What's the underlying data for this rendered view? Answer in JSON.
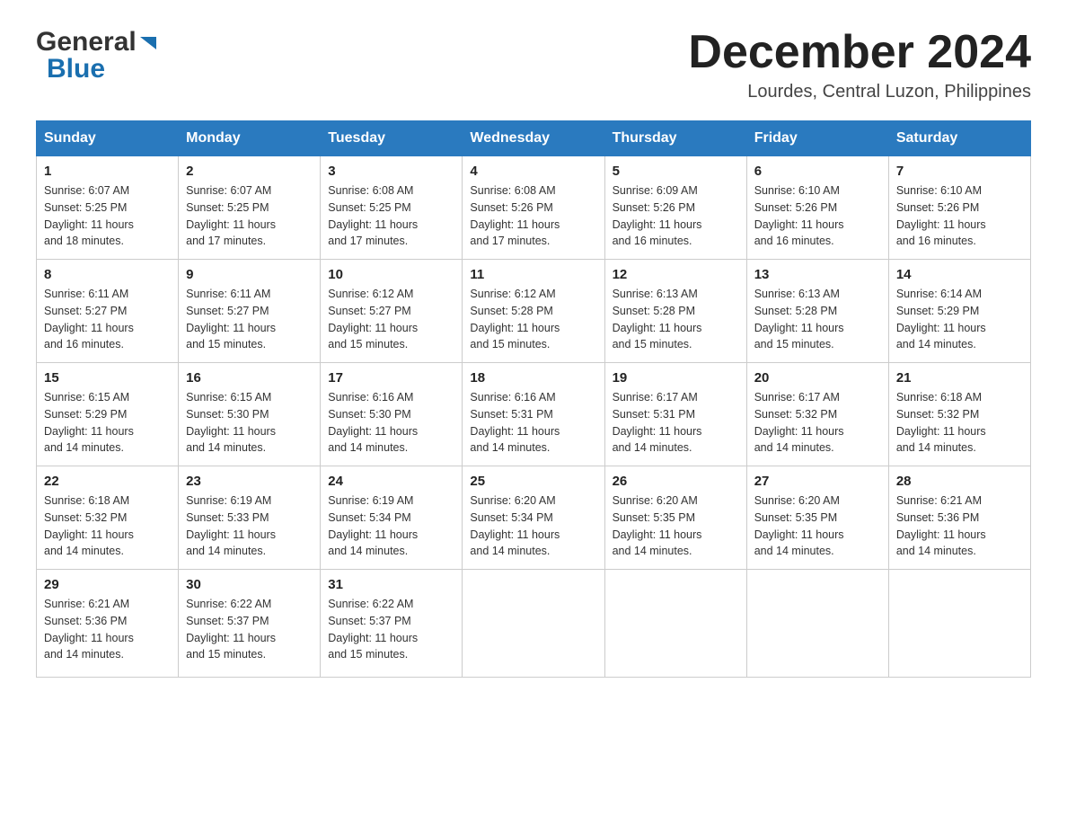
{
  "header": {
    "logo_general": "General",
    "logo_blue": "Blue",
    "month_title": "December 2024",
    "location": "Lourdes, Central Luzon, Philippines"
  },
  "days_of_week": [
    "Sunday",
    "Monday",
    "Tuesday",
    "Wednesday",
    "Thursday",
    "Friday",
    "Saturday"
  ],
  "weeks": [
    [
      {
        "day": "1",
        "sunrise": "6:07 AM",
        "sunset": "5:25 PM",
        "daylight": "11 hours and 18 minutes."
      },
      {
        "day": "2",
        "sunrise": "6:07 AM",
        "sunset": "5:25 PM",
        "daylight": "11 hours and 17 minutes."
      },
      {
        "day": "3",
        "sunrise": "6:08 AM",
        "sunset": "5:25 PM",
        "daylight": "11 hours and 17 minutes."
      },
      {
        "day": "4",
        "sunrise": "6:08 AM",
        "sunset": "5:26 PM",
        "daylight": "11 hours and 17 minutes."
      },
      {
        "day": "5",
        "sunrise": "6:09 AM",
        "sunset": "5:26 PM",
        "daylight": "11 hours and 16 minutes."
      },
      {
        "day": "6",
        "sunrise": "6:10 AM",
        "sunset": "5:26 PM",
        "daylight": "11 hours and 16 minutes."
      },
      {
        "day": "7",
        "sunrise": "6:10 AM",
        "sunset": "5:26 PM",
        "daylight": "11 hours and 16 minutes."
      }
    ],
    [
      {
        "day": "8",
        "sunrise": "6:11 AM",
        "sunset": "5:27 PM",
        "daylight": "11 hours and 16 minutes."
      },
      {
        "day": "9",
        "sunrise": "6:11 AM",
        "sunset": "5:27 PM",
        "daylight": "11 hours and 15 minutes."
      },
      {
        "day": "10",
        "sunrise": "6:12 AM",
        "sunset": "5:27 PM",
        "daylight": "11 hours and 15 minutes."
      },
      {
        "day": "11",
        "sunrise": "6:12 AM",
        "sunset": "5:28 PM",
        "daylight": "11 hours and 15 minutes."
      },
      {
        "day": "12",
        "sunrise": "6:13 AM",
        "sunset": "5:28 PM",
        "daylight": "11 hours and 15 minutes."
      },
      {
        "day": "13",
        "sunrise": "6:13 AM",
        "sunset": "5:28 PM",
        "daylight": "11 hours and 15 minutes."
      },
      {
        "day": "14",
        "sunrise": "6:14 AM",
        "sunset": "5:29 PM",
        "daylight": "11 hours and 14 minutes."
      }
    ],
    [
      {
        "day": "15",
        "sunrise": "6:15 AM",
        "sunset": "5:29 PM",
        "daylight": "11 hours and 14 minutes."
      },
      {
        "day": "16",
        "sunrise": "6:15 AM",
        "sunset": "5:30 PM",
        "daylight": "11 hours and 14 minutes."
      },
      {
        "day": "17",
        "sunrise": "6:16 AM",
        "sunset": "5:30 PM",
        "daylight": "11 hours and 14 minutes."
      },
      {
        "day": "18",
        "sunrise": "6:16 AM",
        "sunset": "5:31 PM",
        "daylight": "11 hours and 14 minutes."
      },
      {
        "day": "19",
        "sunrise": "6:17 AM",
        "sunset": "5:31 PM",
        "daylight": "11 hours and 14 minutes."
      },
      {
        "day": "20",
        "sunrise": "6:17 AM",
        "sunset": "5:32 PM",
        "daylight": "11 hours and 14 minutes."
      },
      {
        "day": "21",
        "sunrise": "6:18 AM",
        "sunset": "5:32 PM",
        "daylight": "11 hours and 14 minutes."
      }
    ],
    [
      {
        "day": "22",
        "sunrise": "6:18 AM",
        "sunset": "5:32 PM",
        "daylight": "11 hours and 14 minutes."
      },
      {
        "day": "23",
        "sunrise": "6:19 AM",
        "sunset": "5:33 PM",
        "daylight": "11 hours and 14 minutes."
      },
      {
        "day": "24",
        "sunrise": "6:19 AM",
        "sunset": "5:34 PM",
        "daylight": "11 hours and 14 minutes."
      },
      {
        "day": "25",
        "sunrise": "6:20 AM",
        "sunset": "5:34 PM",
        "daylight": "11 hours and 14 minutes."
      },
      {
        "day": "26",
        "sunrise": "6:20 AM",
        "sunset": "5:35 PM",
        "daylight": "11 hours and 14 minutes."
      },
      {
        "day": "27",
        "sunrise": "6:20 AM",
        "sunset": "5:35 PM",
        "daylight": "11 hours and 14 minutes."
      },
      {
        "day": "28",
        "sunrise": "6:21 AM",
        "sunset": "5:36 PM",
        "daylight": "11 hours and 14 minutes."
      }
    ],
    [
      {
        "day": "29",
        "sunrise": "6:21 AM",
        "sunset": "5:36 PM",
        "daylight": "11 hours and 14 minutes."
      },
      {
        "day": "30",
        "sunrise": "6:22 AM",
        "sunset": "5:37 PM",
        "daylight": "11 hours and 15 minutes."
      },
      {
        "day": "31",
        "sunrise": "6:22 AM",
        "sunset": "5:37 PM",
        "daylight": "11 hours and 15 minutes."
      },
      null,
      null,
      null,
      null
    ]
  ],
  "labels": {
    "sunrise": "Sunrise:",
    "sunset": "Sunset:",
    "daylight": "Daylight:"
  }
}
